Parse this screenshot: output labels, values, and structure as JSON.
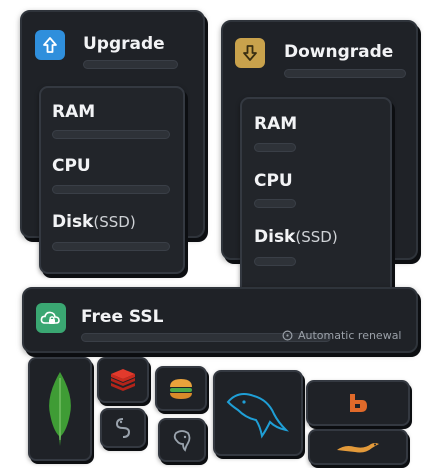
{
  "upgrade": {
    "title": "Upgrade",
    "icon": "arrow-up-icon",
    "icon_color": "#2f8fdc",
    "specs": [
      {
        "label": "RAM",
        "sub": ""
      },
      {
        "label": "CPU",
        "sub": ""
      },
      {
        "label": "Disk",
        "sub": "(SSD)"
      }
    ]
  },
  "downgrade": {
    "title": "Downgrade",
    "icon": "arrow-down-icon",
    "icon_color": "#c9a24c",
    "specs": [
      {
        "label": "RAM",
        "sub": ""
      },
      {
        "label": "CPU",
        "sub": ""
      },
      {
        "label": "Disk",
        "sub": "(SSD)"
      }
    ]
  },
  "ssl": {
    "title": "Free SSL",
    "icon": "cloud-lock-icon",
    "icon_color": "#3aa772",
    "renewal_text": "Automatic renewal"
  },
  "apps": [
    {
      "name": "mongodb-icon",
      "color": "#3f9c35"
    },
    {
      "name": "redis-icon",
      "color": "#d82c20"
    },
    {
      "name": "burger-icon",
      "color": "#e9a23b"
    },
    {
      "name": "mysql-icon",
      "color": "#00758f"
    },
    {
      "name": "bitbucket-icon",
      "color": "#e06a2a"
    },
    {
      "name": "python-icon",
      "color": "#8c96a0"
    },
    {
      "name": "postgresql-icon",
      "color": "#8c96a0"
    },
    {
      "name": "lizard-icon",
      "color": "#e39a3a"
    }
  ]
}
